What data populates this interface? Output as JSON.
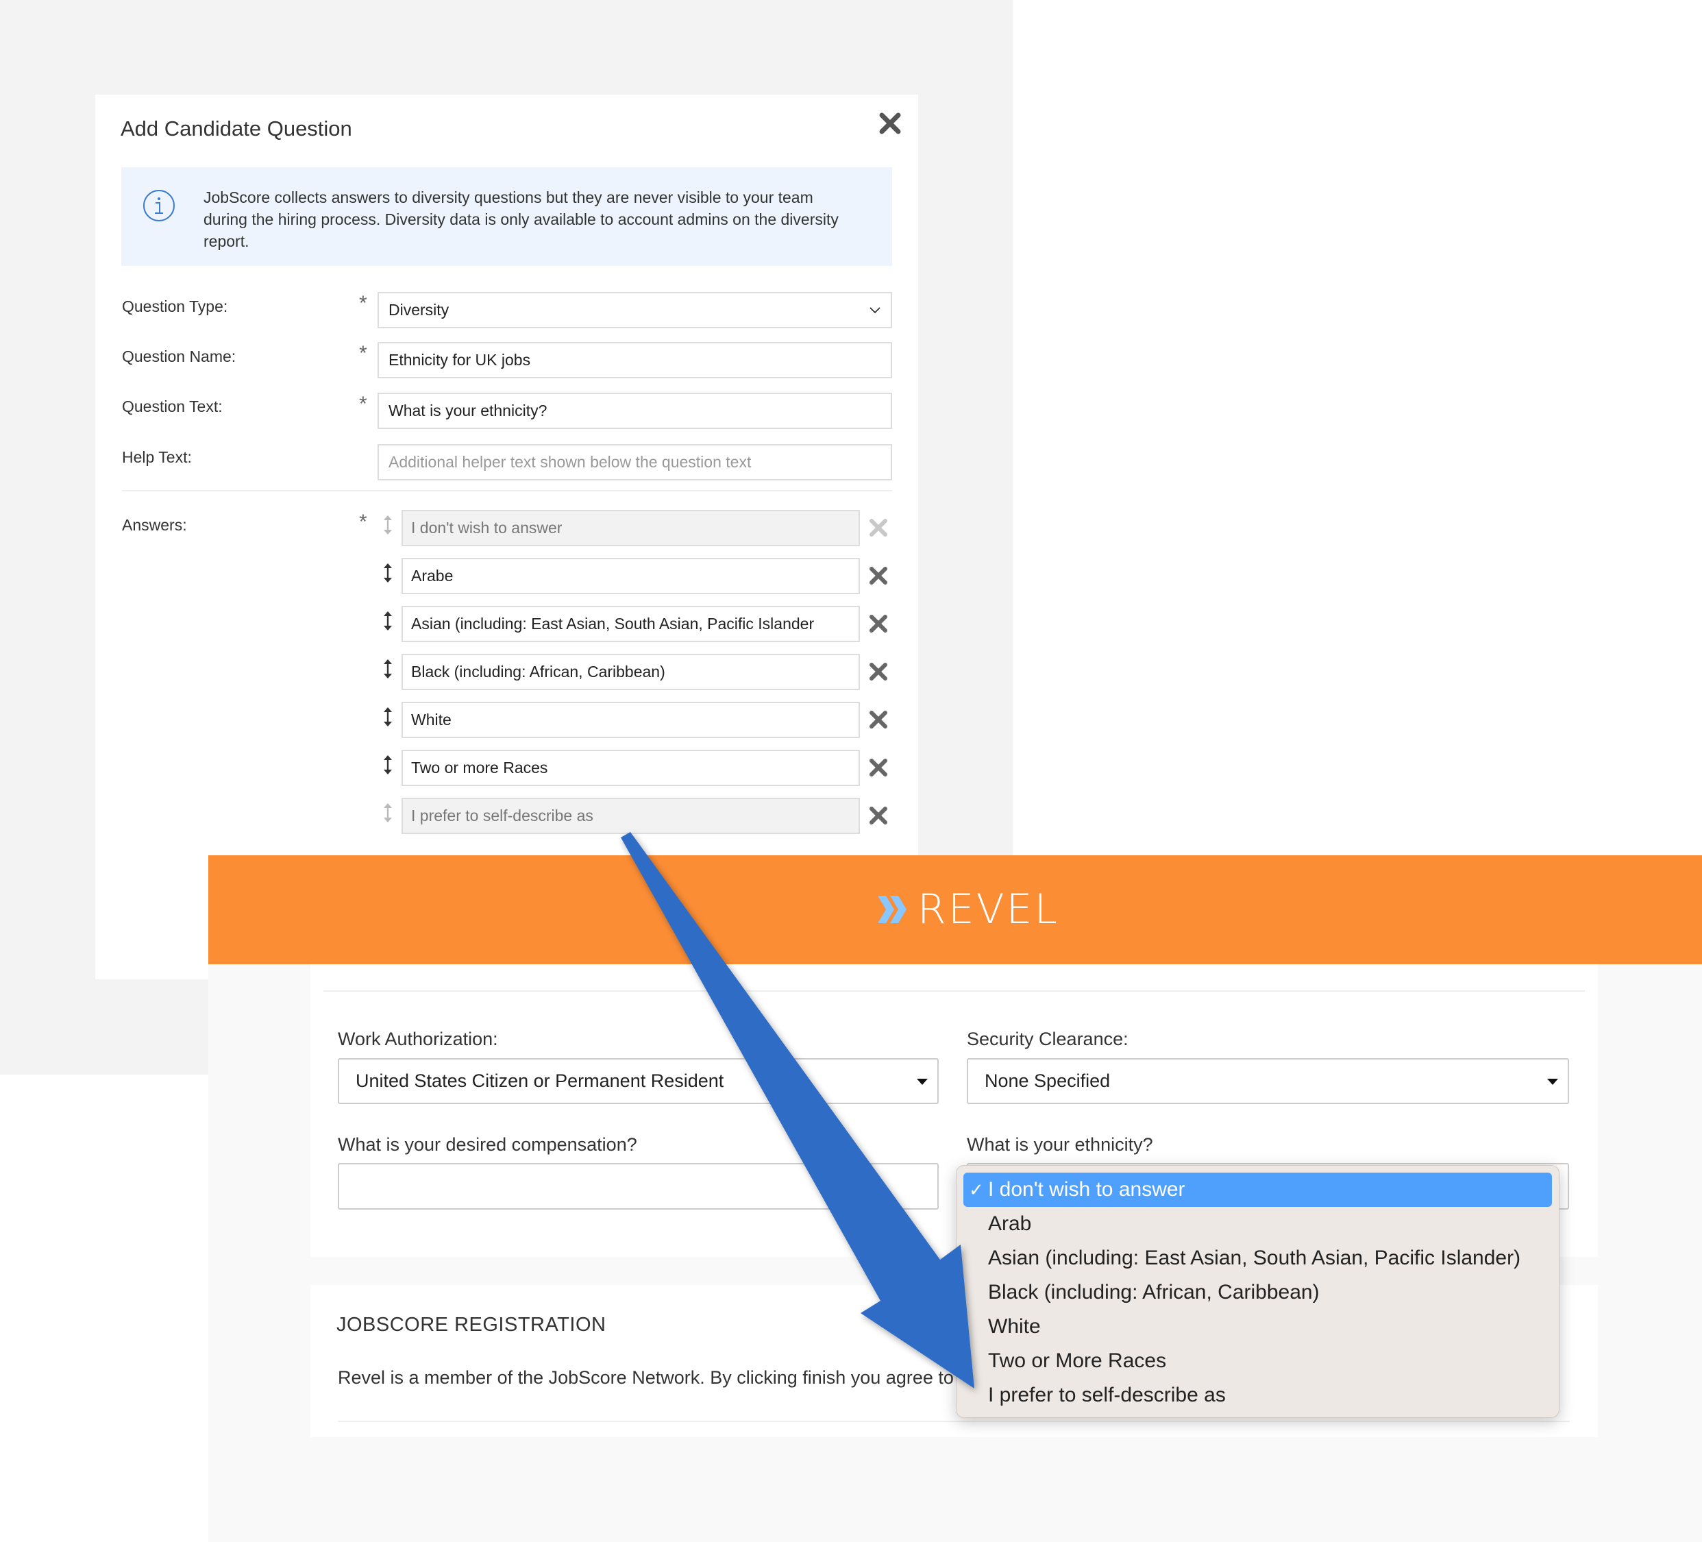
{
  "modal": {
    "title": "Add Candidate Question",
    "close_icon": "close-icon",
    "info_icon": "info-icon",
    "info_text": "JobScore collects answers to diversity questions but they are never visible to your team during the hiring process. Diversity data is only available to account admins on the diversity report.",
    "fields": {
      "question_type": {
        "label": "Question Type:",
        "required": "*",
        "value": "Diversity"
      },
      "question_name": {
        "label": "Question Name:",
        "required": "*",
        "value": "Ethnicity for UK jobs"
      },
      "question_text": {
        "label": "Question Text:",
        "required": "*",
        "value": "What is your ethnicity?"
      },
      "help_text": {
        "label": "Help Text:",
        "placeholder": "Additional helper text shown below the question text"
      }
    },
    "answers_label": "Answers:",
    "answers_required": "*",
    "answers": [
      {
        "value": "I don't wish to answer",
        "locked": true
      },
      {
        "value": "Arabe",
        "locked": false
      },
      {
        "value": "Asian (including: East Asian, South Asian, Pacific Islander",
        "locked": false
      },
      {
        "value": "Black (including: African, Caribbean)",
        "locked": false
      },
      {
        "value": "White",
        "locked": false
      },
      {
        "value": "Two or more Races",
        "locked": false
      },
      {
        "value": "I prefer to self-describe as",
        "locked": true
      }
    ]
  },
  "revel": {
    "brand": "REVEL",
    "brand_color": "#fb8d35",
    "accent_color": "#8ac6ff",
    "work_authorization": {
      "label": "Work Authorization:",
      "value": "United States Citizen or Permanent Resident"
    },
    "security_clearance": {
      "label": "Security Clearance:",
      "value": "None Specified"
    },
    "compensation": {
      "label": "What is your desired compensation?",
      "value": ""
    },
    "ethnicity": {
      "label": "What is your ethnicity?",
      "selected": "I don't wish to answer",
      "options": [
        "I don't wish to answer",
        "Arab",
        "Asian (including: East Asian, South Asian, Pacific Islander)",
        "Black (including: African, Caribbean)",
        "White",
        "Two or More Races",
        "I prefer to self-describe as"
      ],
      "check_mark": "✓"
    },
    "registration": {
      "title": "JOBSCORE REGISTRATION",
      "text": "Revel is a member of the JobScore Network. By clicking finish you agree to JobScore"
    }
  },
  "annotation": {
    "arrow_color": "#2d6cc6"
  }
}
